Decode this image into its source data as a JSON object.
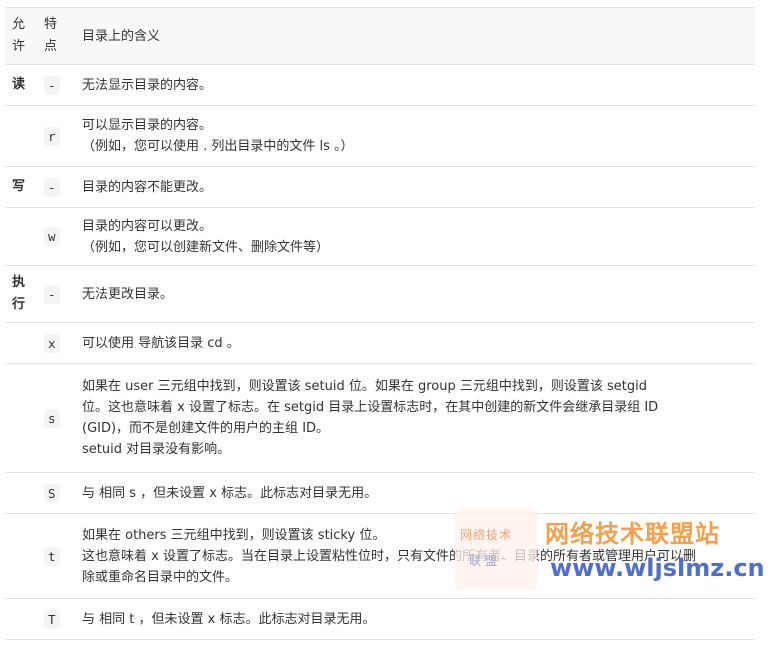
{
  "header": {
    "col1": [
      "允",
      "许"
    ],
    "col2": [
      "特",
      "点"
    ],
    "col3": "目录上的含义"
  },
  "rows": [
    {
      "perm": [
        "读"
      ],
      "feature": "-",
      "lines": [
        "无法显示目录的内容。"
      ]
    },
    {
      "perm": [],
      "feature": "r",
      "lines": [
        "可以显示目录的内容。",
        "（例如，您可以使用 . 列出目录中的文件 ls 。）"
      ]
    },
    {
      "perm": [
        "写"
      ],
      "feature": "-",
      "lines": [
        "目录的内容不能更改。"
      ]
    },
    {
      "perm": [],
      "feature": "w",
      "lines": [
        "目录的内容可以更改。",
        "（例如，您可以创建新文件、删除文件等）"
      ]
    },
    {
      "perm": [
        "执",
        "行"
      ],
      "feature": "-",
      "lines": [
        "无法更改目录。"
      ]
    },
    {
      "perm": [],
      "feature": "x",
      "lines": [
        "可以使用 导航该目录 cd 。"
      ]
    },
    {
      "perm": [],
      "feature": "s",
      "lines": [
        "如果在 user 三元组中找到，则设置该 setuid 位。如果在 group 三元组中找到，则设置该 setgid",
        "位。这也意味着 x 设置了标志。在 setgid 目录上设置标志时，在其中创建的新文件会继承目录组 ID",
        "(GID)，而不是创建文件的用户的主组 ID。",
        "setuid 对目录没有影响。"
      ]
    },
    {
      "perm": [],
      "feature": "S",
      "lines": [
        "与 相同 s ，但未设置 x 标志。此标志对目录无用。"
      ]
    },
    {
      "perm": [],
      "feature": "t",
      "lines": [
        "如果在 others 三元组中找到，则设置该 sticky 位。",
        "这也意味着 x 设置了标志。当在目录上设置粘性位时，只有文件的所有者、目录的所有者或管理用户可以删",
        "除或重命名目录中的文件。"
      ]
    },
    {
      "perm": [],
      "feature": "T",
      "lines": [
        "与 相同 t ，但未设置 x 标志。此标志对目录无用。"
      ]
    }
  ],
  "watermark": {
    "box_line1": "网络技术",
    "box_line2": "联盟",
    "title": "网络技术联盟站",
    "url": "www.wljslmz.cn"
  }
}
